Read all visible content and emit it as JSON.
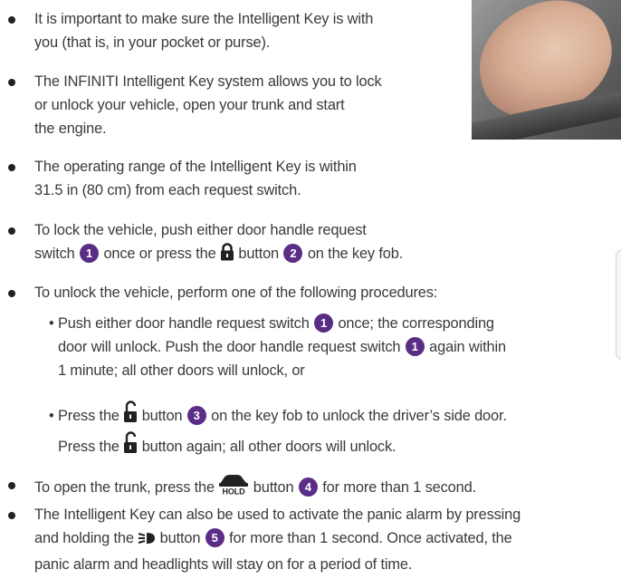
{
  "bullets": {
    "b1": {
      "l1": "It is important to make sure the Intelligent Key is with",
      "l2": "you (that is, in your pocket or purse)."
    },
    "b2": {
      "l1": "The INFINITI Intelligent Key system allows you to lock",
      "l2": "or unlock your vehicle, open your trunk and start",
      "l3": "the engine."
    },
    "b3": {
      "l1": "The operating range of the Intelligent Key is within",
      "l2": "31.5 in (80 cm) from each request switch."
    },
    "b4": {
      "l1": "To lock the vehicle, push either door handle request",
      "l2a": "switch ",
      "l2b": " once or press the ",
      "l2c": " button ",
      "l2d": " on the key fob."
    },
    "b5": {
      "l1": "To unlock the vehicle, perform one of the following procedures:"
    },
    "s1": {
      "l1a": "• Push either door handle request switch ",
      "l1b": " once; the corresponding",
      "l2a": "door will unlock. Push the door handle request switch ",
      "l2b": " again within",
      "l3": "1 minute; all other doors will unlock, or"
    },
    "s2": {
      "l1a": "• Press the ",
      "l1b": " button ",
      "l1c": " on the key fob to unlock the driver’s side door.",
      "l2a": "Press the ",
      "l2b": " button again; all other doors will unlock."
    },
    "b6": {
      "l1a": "To open the trunk, press the ",
      "l1b": " button ",
      "l1c": " for more than 1 second."
    },
    "b7": {
      "l1": "The Intelligent Key can also be used to activate the panic alarm by pressing",
      "l2a": "and holding the ",
      "l2b": " button ",
      "l2c": " for more than 1 second. Once activated, the",
      "l3": "panic alarm and headlights will stay on for a period of time."
    }
  },
  "badges": {
    "n1": "1",
    "n2": "2",
    "n3": "3",
    "n4": "4",
    "n5": "5"
  },
  "icons": {
    "lock": "lock-icon",
    "unlock": "unlock-icon",
    "trunk": "trunk-hold-icon",
    "panic": "panic-alarm-icon",
    "hold_label": "HOLD"
  },
  "colors": {
    "badge": "#5a2d86",
    "text": "#3a3a3a"
  }
}
